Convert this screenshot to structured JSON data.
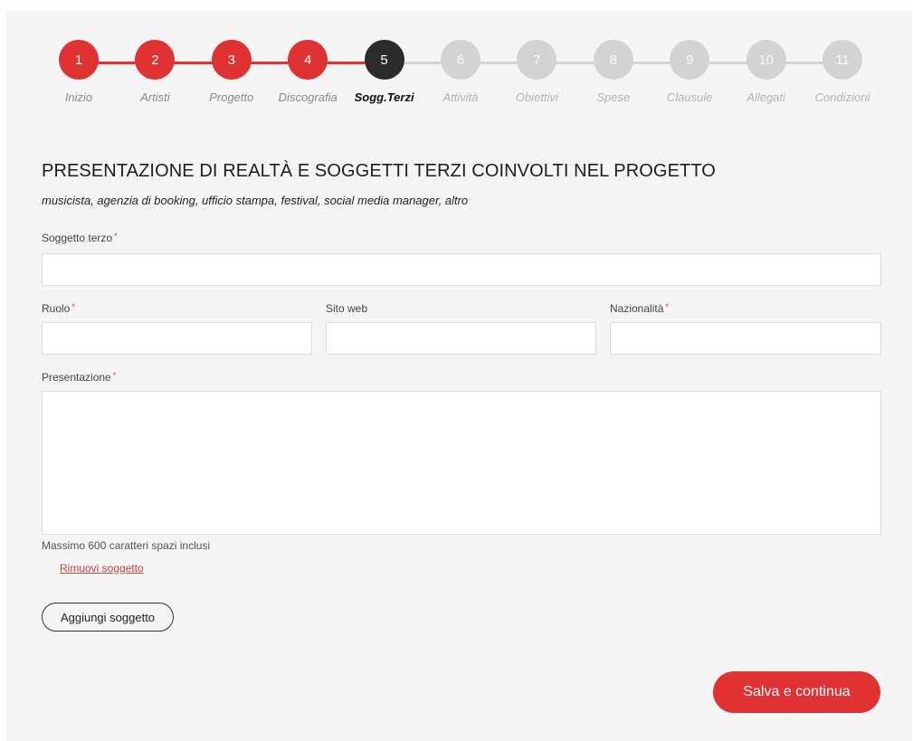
{
  "stepper": {
    "steps": [
      {
        "number": "1",
        "label": "Inizio",
        "state": "done"
      },
      {
        "number": "2",
        "label": "Artisti",
        "state": "done"
      },
      {
        "number": "3",
        "label": "Progetto",
        "state": "done"
      },
      {
        "number": "4",
        "label": "Discografia",
        "state": "done"
      },
      {
        "number": "5",
        "label": "Sogg.Terzi",
        "state": "active"
      },
      {
        "number": "6",
        "label": "Attività",
        "state": "todo"
      },
      {
        "number": "7",
        "label": "Obiettivi",
        "state": "todo"
      },
      {
        "number": "8",
        "label": "Spese",
        "state": "todo"
      },
      {
        "number": "9",
        "label": "Clausule",
        "state": "todo"
      },
      {
        "number": "10",
        "label": "Allegati",
        "state": "todo"
      },
      {
        "number": "11",
        "label": "Condizioni",
        "state": "todo"
      }
    ]
  },
  "section": {
    "title": "PRESENTAZIONE DI REALTÀ E SOGGETTI TERZI COINVOLTI NEL PROGETTO",
    "subtitle": "musicista, agenzia di booking, ufficio stampa, festival, social media manager, altro"
  },
  "form": {
    "soggetto_label": "Soggetto terzo",
    "ruolo_label": "Ruolo",
    "sito_label": "Sito web",
    "nazionalita_label": "Nazionalità",
    "presentazione_label": "Presentazione",
    "required_mark": "*",
    "hint": "Massimo 600 caratteri spazi inclusi",
    "remove_link": "Rimuovi soggetto",
    "add_button": "Aggiungi soggetto",
    "save_button": "Salva e continua"
  },
  "colors": {
    "accent": "#e03232",
    "active_step": "#2b2b2b",
    "inactive_step": "#d3d3d3"
  }
}
